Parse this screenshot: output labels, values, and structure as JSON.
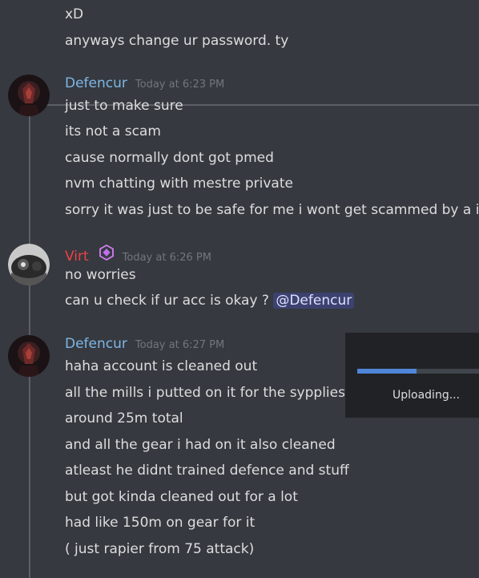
{
  "colors": {
    "background": "#36393f",
    "defencur_name": "#7eb7e6",
    "virt_name": "#ed4245",
    "timestamp": "#72767d",
    "mention_bg": "#3c4270",
    "progress": "#4f86d8"
  },
  "top_messages": [
    "xD",
    "anyways change ur password. ty"
  ],
  "groups": [
    {
      "author": "Defencur",
      "time": "Today at 6:23 PM",
      "lines": [
        "just to make sure",
        "its not a scam",
        "cause normally dont got pmed",
        "nvm chatting with mestre private",
        "sorry it was just to be safe for me i wont get scammed by a imp"
      ]
    },
    {
      "author": "Virt",
      "badge_icon": "nitro-gem-icon",
      "time": "Today at 6:26 PM",
      "lines": [
        "no worries",
        "can u check if ur acc is okay ?"
      ],
      "mention": "@Defencur"
    },
    {
      "author": "Defencur",
      "time": "Today at 6:27 PM",
      "lines": [
        "haha account is cleaned out",
        "all the mills i putted on it for the sypplies",
        "around 25m total",
        "and all the gear i had on it also cleaned",
        "atleast he didnt trained defence and stuff",
        "but got kinda cleaned out for a lot",
        "had like 150m on gear for it",
        "( just rapier from 75 attack)"
      ]
    }
  ],
  "upload": {
    "label": "Uploading...",
    "progress": 0.49
  }
}
